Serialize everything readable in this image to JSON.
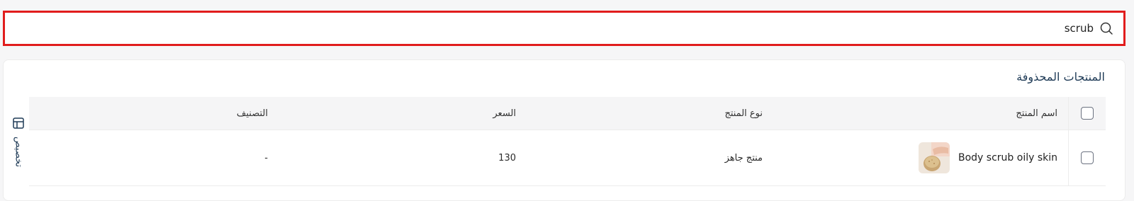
{
  "search": {
    "value": "scrub",
    "icon": "search-icon"
  },
  "card": {
    "title": "المنتجات المحذوفة",
    "customize_label": "تخصيص",
    "customize_icon": "table-layout-icon"
  },
  "table": {
    "headers": {
      "name": "اسم المنتج",
      "type": "نوع المنتج",
      "price": "السعر",
      "category": "التصنيف"
    },
    "rows": [
      {
        "name": "Body scrub oily skin",
        "type": "منتج جاهز",
        "price": "130",
        "category": "-",
        "thumbnail": "product-thumbnail"
      }
    ]
  },
  "colors": {
    "highlight_border": "#e11d1d",
    "title_text": "#1f3b57",
    "header_bg": "#f5f5f6"
  }
}
